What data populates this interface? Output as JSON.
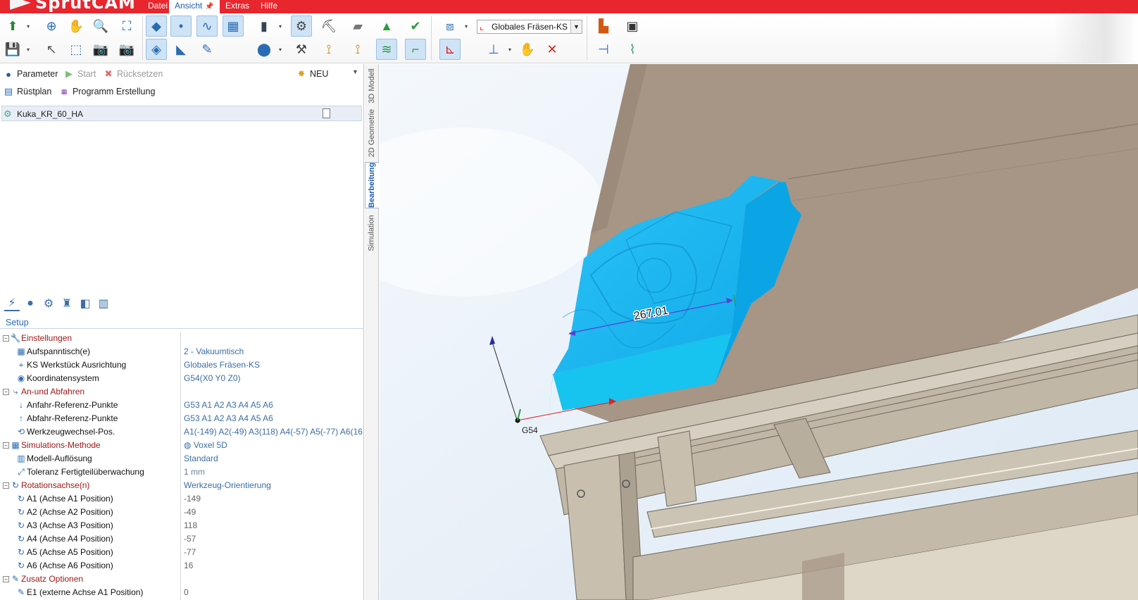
{
  "app": {
    "logo_text": "SprutCAM"
  },
  "menu": {
    "items": [
      {
        "label": "Datei"
      },
      {
        "label": "Ansicht"
      },
      {
        "label": "Extras"
      },
      {
        "label": "Hilfe"
      }
    ],
    "active": "Ansicht"
  },
  "toolbar": {
    "coord_system_select": "Globales Fräsen-KS"
  },
  "left_panel": {
    "actions": {
      "parameter": "Parameter",
      "start": "Start",
      "reset": "Rücksetzen",
      "new": "NEU",
      "setup_plan": "Rüstplan",
      "program_creation": "Programm Erstellung"
    },
    "project_item": "Kuka_KR_60_HA",
    "setup_tab_label": "Setup"
  },
  "properties": [
    {
      "key": "Einstellungen",
      "value": "",
      "category": true,
      "expanded": true,
      "icon": "wrench-icon"
    },
    {
      "key": "Aufspanntisch(e)",
      "value": "2 - Vakuumtisch",
      "icon": "table-icon"
    },
    {
      "key": "KS Werkstück Ausrichtung",
      "value": "Globales Fräsen-KS",
      "icon": "workpiece-cs-icon"
    },
    {
      "key": "Koordinatensystem",
      "value": "G54(X0 Y0 Z0)",
      "icon": "coordinate-icon"
    },
    {
      "key": "An-und Abfahren",
      "value": "",
      "category": true,
      "expanded": true,
      "icon": "approach-icon"
    },
    {
      "key": "Anfahr-Referenz-Punkte",
      "value": "G53 A1 A2 A3 A4 A5 A6",
      "icon": "approach-point-icon"
    },
    {
      "key": "Abfahr-Referenz-Punkte",
      "value": "G53 A1 A2 A3 A4 A5 A6",
      "icon": "retract-point-icon"
    },
    {
      "key": "Werkzeugwechsel-Pos.",
      "value": "A1(-149) A2(-49) A3(118) A4(-57) A5(-77) A6(16",
      "icon": "tool-change-icon"
    },
    {
      "key": "Simulations-Methode",
      "value": "Voxel 5D",
      "category": true,
      "expanded": true,
      "icon": "simulation-icon"
    },
    {
      "key": "Modell-Auflösung",
      "value": "Standard",
      "icon": "resolution-icon"
    },
    {
      "key": "Toleranz Fertigteilüberwachung",
      "value": "1 mm",
      "plain": true,
      "icon": "tolerance-icon"
    },
    {
      "key": "Rotationsachse(n)",
      "value": "Werkzeug-Orientierung",
      "category": true,
      "expanded": true,
      "icon": "rotation-axis-icon"
    },
    {
      "key": "A1 (Achse A1 Position)",
      "value": "-149",
      "numeric": true,
      "icon": "axis-icon"
    },
    {
      "key": "A2 (Achse A2 Position)",
      "value": "-49",
      "numeric": true,
      "icon": "axis-icon"
    },
    {
      "key": "A3 (Achse A3 Position)",
      "value": "118",
      "numeric": true,
      "icon": "axis-icon"
    },
    {
      "key": "A4 (Achse A4 Position)",
      "value": "-57",
      "numeric": true,
      "icon": "axis-icon"
    },
    {
      "key": "A5 (Achse A5 Position)",
      "value": "-77",
      "numeric": true,
      "icon": "axis-icon"
    },
    {
      "key": "A6 (Achse A6 Position)",
      "value": "16",
      "numeric": true,
      "icon": "axis-icon"
    },
    {
      "key": "Zusatz Optionen",
      "value": "",
      "category": true,
      "expanded": true,
      "icon": "options-icon"
    },
    {
      "key": "E1 (externe Achse A1 Position)",
      "value": "0",
      "numeric": true,
      "icon": "external-axis-icon"
    }
  ],
  "vertical_tabs": [
    {
      "label": "3D Modell"
    },
    {
      "label": "2D Geometrie"
    },
    {
      "label": "Bearbeitung",
      "selected": true
    },
    {
      "label": "Simulation"
    }
  ],
  "viewport": {
    "dimension_label": "267.01",
    "cs_label": "G54"
  },
  "colors": {
    "menubar": "#e8262e",
    "workpiece": "#19b8f0",
    "table_surface": "#a79586",
    "frame": "#c9c1b1"
  }
}
